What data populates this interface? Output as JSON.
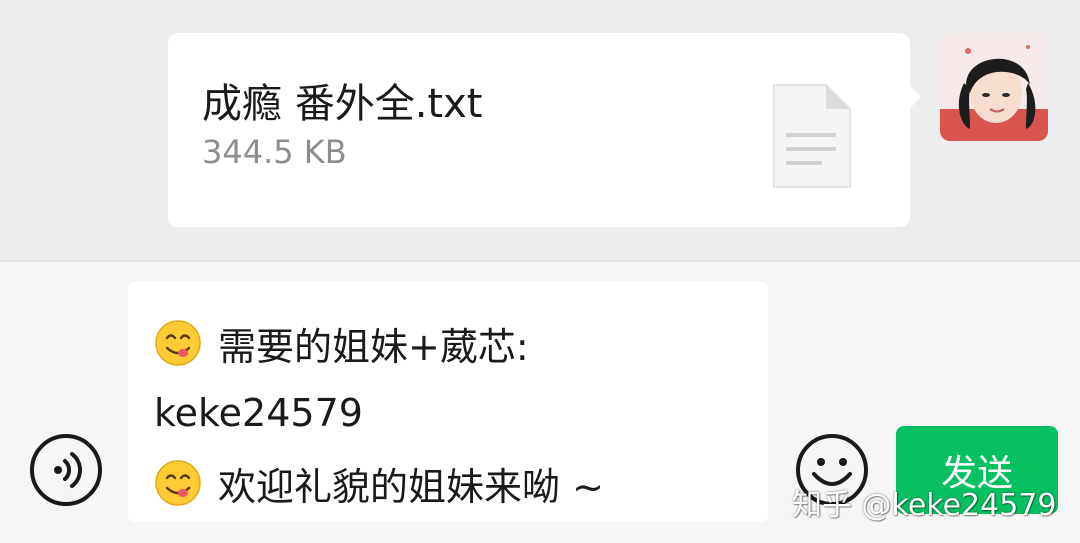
{
  "chat": {
    "file_message": {
      "file_name": "成瘾 番外全.txt",
      "file_size": "344.5 KB",
      "icon": "document-icon"
    },
    "sender_avatar": "avatar"
  },
  "input": {
    "lines": [
      {
        "emoji": "yum-emoji",
        "text": "需要的姐妹+葳芯:"
      },
      {
        "emoji": "",
        "text": "keke24579"
      },
      {
        "emoji": "yum-emoji",
        "text": "欢迎礼貌的姐妹来呦 ~"
      }
    ],
    "voice_icon": "voice-icon",
    "emoji_icon": "emoji-icon",
    "send_label": "发送"
  },
  "watermark": "知乎 @keke24579",
  "colors": {
    "background": "#ededed",
    "bubble": "#ffffff",
    "send_button": "#07c160"
  }
}
